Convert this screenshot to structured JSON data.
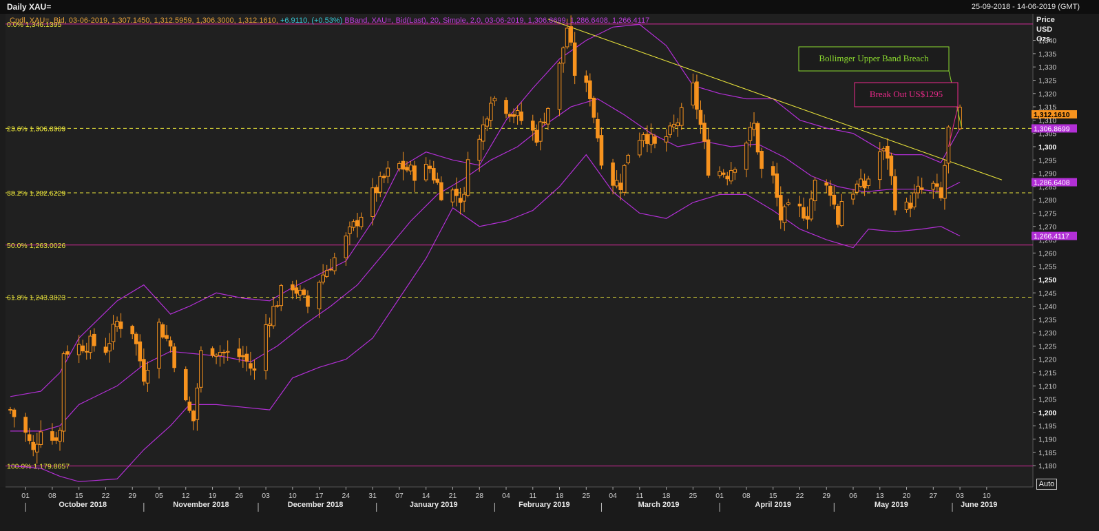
{
  "window": {
    "title": "Daily XAU=",
    "date_range": "25-09-2018 - 14-06-2019 (GMT)",
    "auto_button": "Auto"
  },
  "legend": {
    "candle_info": "Cndl, XAU=, Bid, 03-06-2019, 1,307.1450, 1,312.5959, 1,306.3000, 1,312.1610,",
    "candle_change": "+6.9110, (+0.53%)",
    "bband_info": "BBand, XAU=, Bid(Last), 20, Simple, 2.0, 03-06-2019, 1,306.8699, 1,286.6408, 1,266.4117"
  },
  "colors": {
    "candle_up": "#f7931e",
    "candle_down": "#f7931e",
    "bollinger": "#b22fd6",
    "fib_line": "#e8e23a",
    "fib_label": "#e8e23a",
    "fib_solid": "#d42a9a",
    "trendline": "#e8e23a",
    "annotation_green": "#8ddb2f",
    "annotation_pink": "#ee2a8c",
    "price_last_bg": "#f7931e",
    "band_tag_bg": "#b22fd6"
  },
  "chart_data": {
    "type": "candlestick",
    "title": "Daily XAU=",
    "yaxis": {
      "label_lines": [
        "Price",
        "USD",
        "Ozs"
      ],
      "range": [
        1172,
        1350
      ],
      "ticks": [
        1180,
        1185,
        1190,
        1195,
        1200,
        1205,
        1210,
        1215,
        1220,
        1225,
        1230,
        1235,
        1240,
        1245,
        1250,
        1255,
        1260,
        1265,
        1270,
        1275,
        1280,
        1285,
        1290,
        1295,
        1300,
        1305,
        1310,
        1315,
        1320,
        1325,
        1330,
        1335,
        1340
      ],
      "tick_labels": [
        "1,180",
        "1,185",
        "1,190",
        "1,195",
        "1,200",
        "1,205",
        "1,210",
        "1,215",
        "1,220",
        "1,225",
        "1,230",
        "1,235",
        "1,240",
        "1,245",
        "1,250",
        "1,255",
        "1,260",
        "1,265",
        "1,270",
        "1,275",
        "1,280",
        "1,285",
        "1,290",
        "1,295",
        "1,300",
        "1,305",
        "1,310",
        "1,315",
        "1,320",
        "1,325",
        "1,330",
        "1,335",
        "1,340"
      ],
      "bold_ticks": [
        1200,
        1250,
        1300
      ]
    },
    "xaxis": {
      "start": "2018-09-27",
      "end": "2019-06-14",
      "day_ticks": [
        {
          "date": "2018-10-01",
          "label": "01"
        },
        {
          "date": "2018-10-08",
          "label": "08"
        },
        {
          "date": "2018-10-15",
          "label": "15"
        },
        {
          "date": "2018-10-22",
          "label": "22"
        },
        {
          "date": "2018-10-29",
          "label": "29"
        },
        {
          "date": "2018-11-05",
          "label": "05"
        },
        {
          "date": "2018-11-12",
          "label": "12"
        },
        {
          "date": "2018-11-19",
          "label": "19"
        },
        {
          "date": "2018-11-26",
          "label": "26"
        },
        {
          "date": "2018-12-03",
          "label": "03"
        },
        {
          "date": "2018-12-10",
          "label": "10"
        },
        {
          "date": "2018-12-17",
          "label": "17"
        },
        {
          "date": "2018-12-24",
          "label": "24"
        },
        {
          "date": "2018-12-31",
          "label": "31"
        },
        {
          "date": "2019-01-07",
          "label": "07"
        },
        {
          "date": "2019-01-14",
          "label": "14"
        },
        {
          "date": "2019-01-21",
          "label": "21"
        },
        {
          "date": "2019-01-28",
          "label": "28"
        },
        {
          "date": "2019-02-04",
          "label": "04"
        },
        {
          "date": "2019-02-11",
          "label": "11"
        },
        {
          "date": "2019-02-18",
          "label": "18"
        },
        {
          "date": "2019-02-25",
          "label": "25"
        },
        {
          "date": "2019-03-04",
          "label": "04"
        },
        {
          "date": "2019-03-11",
          "label": "11"
        },
        {
          "date": "2019-03-18",
          "label": "18"
        },
        {
          "date": "2019-03-25",
          "label": "25"
        },
        {
          "date": "2019-04-01",
          "label": "01"
        },
        {
          "date": "2019-04-08",
          "label": "08"
        },
        {
          "date": "2019-04-15",
          "label": "15"
        },
        {
          "date": "2019-04-22",
          "label": "22"
        },
        {
          "date": "2019-04-29",
          "label": "29"
        },
        {
          "date": "2019-05-06",
          "label": "06"
        },
        {
          "date": "2019-05-13",
          "label": "13"
        },
        {
          "date": "2019-05-20",
          "label": "20"
        },
        {
          "date": "2019-05-27",
          "label": "27"
        },
        {
          "date": "2019-06-03",
          "label": "03"
        },
        {
          "date": "2019-06-10",
          "label": "10"
        }
      ],
      "month_labels": [
        {
          "date": "2018-10-16",
          "label": "October 2018"
        },
        {
          "date": "2018-11-16",
          "label": "November 2018"
        },
        {
          "date": "2018-12-16",
          "label": "December 2018"
        },
        {
          "date": "2019-01-16",
          "label": "January 2019"
        },
        {
          "date": "2019-02-14",
          "label": "February 2019"
        },
        {
          "date": "2019-03-16",
          "label": "March 2019"
        },
        {
          "date": "2019-04-15",
          "label": "April 2019"
        },
        {
          "date": "2019-05-16",
          "label": "May 2019"
        },
        {
          "date": "2019-06-08",
          "label": "June 2019"
        }
      ],
      "month_separators": [
        "2018-10-01",
        "2018-11-01",
        "2018-12-01",
        "2019-01-01",
        "2019-02-01",
        "2019-03-01",
        "2019-04-01",
        "2019-05-01",
        "2019-06-01"
      ]
    },
    "fib_levels": [
      {
        "label": "0.0%",
        "value_text": "1,346.1395",
        "value": 1346.1395,
        "style": "solid"
      },
      {
        "label": "23.6%",
        "value_text": "1,306.8989",
        "value": 1306.8989,
        "style": "dashed"
      },
      {
        "label": "38.2%",
        "value_text": "1,282.6229",
        "value": 1282.6229,
        "style": "dashed"
      },
      {
        "label": "50.0%",
        "value_text": "1,263.0026",
        "value": 1263.0026,
        "style": "solid"
      },
      {
        "label": "61.8%",
        "value_text": "1,243.3823",
        "value": 1243.3823,
        "style": "dashed"
      },
      {
        "label": "100.0%",
        "value_text": "1,179.8657",
        "value": 1179.8657,
        "style": "solid"
      }
    ],
    "trendline": {
      "from": {
        "date": "2019-02-15",
        "value": 1348
      },
      "to": {
        "date": "2019-06-14",
        "value": 1287.5
      }
    },
    "annotations": [
      {
        "text": "Bollimger Upper Band Breach",
        "color": "green",
        "arrow_to": {
          "date": "2019-06-03",
          "value": 1307.5
        }
      },
      {
        "text": "Break Out US$1295",
        "color": "pink",
        "arrow_to": {
          "date": "2019-05-31",
          "value": 1300
        }
      }
    ],
    "price_tags": [
      {
        "text": "1,312.1610",
        "value": 1312.161,
        "kind": "last"
      },
      {
        "text": "1,306.8699",
        "value": 1306.8699,
        "kind": "band"
      },
      {
        "text": "1,286.6408",
        "value": 1286.6408,
        "kind": "band"
      },
      {
        "text": "1,266.4117",
        "value": 1266.4117,
        "kind": "band"
      }
    ],
    "close_anchors": [
      [
        "2018-09-27",
        1201
      ],
      [
        "2018-10-01",
        1192
      ],
      [
        "2018-10-03",
        1185
      ],
      [
        "2018-10-05",
        1195
      ],
      [
        "2018-10-08",
        1190
      ],
      [
        "2018-10-10",
        1193
      ],
      [
        "2018-10-11",
        1223
      ],
      [
        "2018-10-15",
        1225
      ],
      [
        "2018-10-18",
        1226
      ],
      [
        "2018-10-22",
        1224
      ],
      [
        "2018-10-25",
        1234
      ],
      [
        "2018-10-29",
        1231
      ],
      [
        "2018-11-01",
        1214
      ],
      [
        "2018-11-05",
        1233
      ],
      [
        "2018-11-08",
        1225
      ],
      [
        "2018-11-12",
        1203
      ],
      [
        "2018-11-14",
        1197
      ],
      [
        "2018-11-16",
        1222
      ],
      [
        "2018-11-19",
        1224
      ],
      [
        "2018-11-23",
        1222
      ],
      [
        "2018-11-27",
        1221
      ],
      [
        "2018-11-30",
        1215
      ],
      [
        "2018-12-03",
        1233
      ],
      [
        "2018-12-07",
        1245
      ],
      [
        "2018-12-10",
        1248
      ],
      [
        "2018-12-14",
        1240
      ],
      [
        "2018-12-17",
        1250
      ],
      [
        "2018-12-21",
        1258
      ],
      [
        "2018-12-24",
        1265
      ],
      [
        "2018-12-26",
        1270
      ],
      [
        "2018-12-31",
        1282
      ],
      [
        "2019-01-04",
        1290
      ],
      [
        "2019-01-07",
        1293
      ],
      [
        "2019-01-11",
        1290
      ],
      [
        "2019-01-15",
        1292
      ],
      [
        "2019-01-18",
        1283
      ],
      [
        "2019-01-21",
        1283
      ],
      [
        "2019-01-24",
        1280
      ],
      [
        "2019-01-25",
        1298
      ],
      [
        "2019-01-28",
        1302
      ],
      [
        "2019-01-31",
        1319
      ],
      [
        "2019-02-04",
        1315
      ],
      [
        "2019-02-08",
        1310
      ],
      [
        "2019-02-12",
        1304
      ],
      [
        "2019-02-15",
        1315
      ],
      [
        "2019-02-18",
        1330
      ],
      [
        "2019-02-20",
        1345
      ],
      [
        "2019-02-22",
        1328
      ],
      [
        "2019-02-26",
        1320
      ],
      [
        "2019-03-01",
        1296
      ],
      [
        "2019-03-04",
        1287
      ],
      [
        "2019-03-06",
        1286
      ],
      [
        "2019-03-08",
        1298
      ],
      [
        "2019-03-12",
        1306
      ],
      [
        "2019-03-15",
        1300
      ],
      [
        "2019-03-19",
        1305
      ],
      [
        "2019-03-22",
        1312
      ],
      [
        "2019-03-25",
        1322
      ],
      [
        "2019-03-27",
        1308
      ],
      [
        "2019-03-29",
        1292
      ],
      [
        "2019-04-03",
        1290
      ],
      [
        "2019-04-05",
        1294
      ],
      [
        "2019-04-10",
        1308
      ],
      [
        "2019-04-12",
        1291
      ],
      [
        "2019-04-15",
        1288
      ],
      [
        "2019-04-17",
        1273
      ],
      [
        "2019-04-19",
        1276
      ],
      [
        "2019-04-22",
        1276
      ],
      [
        "2019-04-24",
        1275
      ],
      [
        "2019-04-26",
        1286
      ],
      [
        "2019-04-30",
        1284
      ],
      [
        "2019-05-02",
        1272
      ],
      [
        "2019-05-03",
        1280
      ],
      [
        "2019-05-07",
        1285
      ],
      [
        "2019-05-09",
        1285
      ],
      [
        "2019-05-13",
        1298
      ],
      [
        "2019-05-15",
        1297
      ],
      [
        "2019-05-17",
        1279
      ],
      [
        "2019-05-20",
        1277
      ],
      [
        "2019-05-23",
        1283
      ],
      [
        "2019-05-27",
        1285
      ],
      [
        "2019-05-29",
        1280
      ],
      [
        "2019-05-31",
        1306
      ],
      [
        "2019-06-03",
        1312
      ]
    ],
    "bollinger_upper": [
      [
        "2018-09-27",
        1206
      ],
      [
        "2018-10-05",
        1208
      ],
      [
        "2018-10-10",
        1215
      ],
      [
        "2018-10-15",
        1228
      ],
      [
        "2018-10-25",
        1242
      ],
      [
        "2018-11-01",
        1248
      ],
      [
        "2018-11-08",
        1237
      ],
      [
        "2018-11-13",
        1240
      ],
      [
        "2018-11-20",
        1245
      ],
      [
        "2018-11-27",
        1243
      ],
      [
        "2018-12-04",
        1242
      ],
      [
        "2018-12-10",
        1247
      ],
      [
        "2018-12-17",
        1252
      ],
      [
        "2018-12-24",
        1257
      ],
      [
        "2018-12-31",
        1272
      ],
      [
        "2019-01-07",
        1292
      ],
      [
        "2019-01-14",
        1298
      ],
      [
        "2019-01-21",
        1295
      ],
      [
        "2019-01-28",
        1293
      ],
      [
        "2019-02-04",
        1310
      ],
      [
        "2019-02-11",
        1322
      ],
      [
        "2019-02-18",
        1333
      ],
      [
        "2019-02-25",
        1340
      ],
      [
        "2019-03-04",
        1345
      ],
      [
        "2019-03-11",
        1346
      ],
      [
        "2019-03-18",
        1338
      ],
      [
        "2019-03-25",
        1323
      ],
      [
        "2019-04-01",
        1320
      ],
      [
        "2019-04-08",
        1318
      ],
      [
        "2019-04-15",
        1318
      ],
      [
        "2019-04-22",
        1310
      ],
      [
        "2019-04-29",
        1307
      ],
      [
        "2019-05-06",
        1305
      ],
      [
        "2019-05-13",
        1299
      ],
      [
        "2019-05-17",
        1297
      ],
      [
        "2019-05-24",
        1297
      ],
      [
        "2019-05-29",
        1294
      ],
      [
        "2019-06-03",
        1306.87
      ]
    ],
    "bollinger_middle": [
      [
        "2018-09-27",
        1193
      ],
      [
        "2018-10-05",
        1193
      ],
      [
        "2018-10-10",
        1195
      ],
      [
        "2018-10-15",
        1203
      ],
      [
        "2018-10-25",
        1210
      ],
      [
        "2018-11-01",
        1218
      ],
      [
        "2018-11-08",
        1223
      ],
      [
        "2018-11-15",
        1222
      ],
      [
        "2018-11-22",
        1221
      ],
      [
        "2018-11-29",
        1219
      ],
      [
        "2018-12-06",
        1225
      ],
      [
        "2018-12-13",
        1233
      ],
      [
        "2018-12-20",
        1240
      ],
      [
        "2018-12-27",
        1248
      ],
      [
        "2019-01-03",
        1260
      ],
      [
        "2019-01-10",
        1272
      ],
      [
        "2019-01-17",
        1282
      ],
      [
        "2019-01-24",
        1288
      ],
      [
        "2019-01-31",
        1295
      ],
      [
        "2019-02-07",
        1300
      ],
      [
        "2019-02-14",
        1308
      ],
      [
        "2019-02-21",
        1315
      ],
      [
        "2019-02-28",
        1318
      ],
      [
        "2019-03-07",
        1312
      ],
      [
        "2019-03-14",
        1305
      ],
      [
        "2019-03-21",
        1300
      ],
      [
        "2019-03-28",
        1302
      ],
      [
        "2019-04-04",
        1300
      ],
      [
        "2019-04-11",
        1301
      ],
      [
        "2019-04-18",
        1296
      ],
      [
        "2019-04-25",
        1289
      ],
      [
        "2019-05-02",
        1285
      ],
      [
        "2019-05-09",
        1283
      ],
      [
        "2019-05-16",
        1284
      ],
      [
        "2019-05-23",
        1284
      ],
      [
        "2019-05-29",
        1283
      ],
      [
        "2019-06-03",
        1286.64
      ]
    ],
    "bollinger_lower": [
      [
        "2018-09-27",
        1180
      ],
      [
        "2018-10-05",
        1179
      ],
      [
        "2018-10-10",
        1176
      ],
      [
        "2018-10-15",
        1174
      ],
      [
        "2018-10-25",
        1175
      ],
      [
        "2018-11-01",
        1186
      ],
      [
        "2018-11-08",
        1195
      ],
      [
        "2018-11-13",
        1203
      ],
      [
        "2018-11-20",
        1203
      ],
      [
        "2018-11-27",
        1202
      ],
      [
        "2018-12-04",
        1201
      ],
      [
        "2018-12-10",
        1213
      ],
      [
        "2018-12-17",
        1217
      ],
      [
        "2018-12-24",
        1220
      ],
      [
        "2018-12-31",
        1228
      ],
      [
        "2019-01-07",
        1243
      ],
      [
        "2019-01-14",
        1258
      ],
      [
        "2019-01-21",
        1277
      ],
      [
        "2019-01-28",
        1270
      ],
      [
        "2019-02-04",
        1272
      ],
      [
        "2019-02-11",
        1276
      ],
      [
        "2019-02-18",
        1285
      ],
      [
        "2019-02-25",
        1297
      ],
      [
        "2019-03-04",
        1283
      ],
      [
        "2019-03-11",
        1275
      ],
      [
        "2019-03-18",
        1273
      ],
      [
        "2019-03-25",
        1279
      ],
      [
        "2019-04-01",
        1282
      ],
      [
        "2019-04-08",
        1282
      ],
      [
        "2019-04-15",
        1276
      ],
      [
        "2019-04-22",
        1269
      ],
      [
        "2019-04-29",
        1265
      ],
      [
        "2019-05-06",
        1262
      ],
      [
        "2019-05-10",
        1269
      ],
      [
        "2019-05-17",
        1268
      ],
      [
        "2019-05-24",
        1269
      ],
      [
        "2019-05-29",
        1270
      ],
      [
        "2019-06-03",
        1266.41
      ]
    ]
  }
}
